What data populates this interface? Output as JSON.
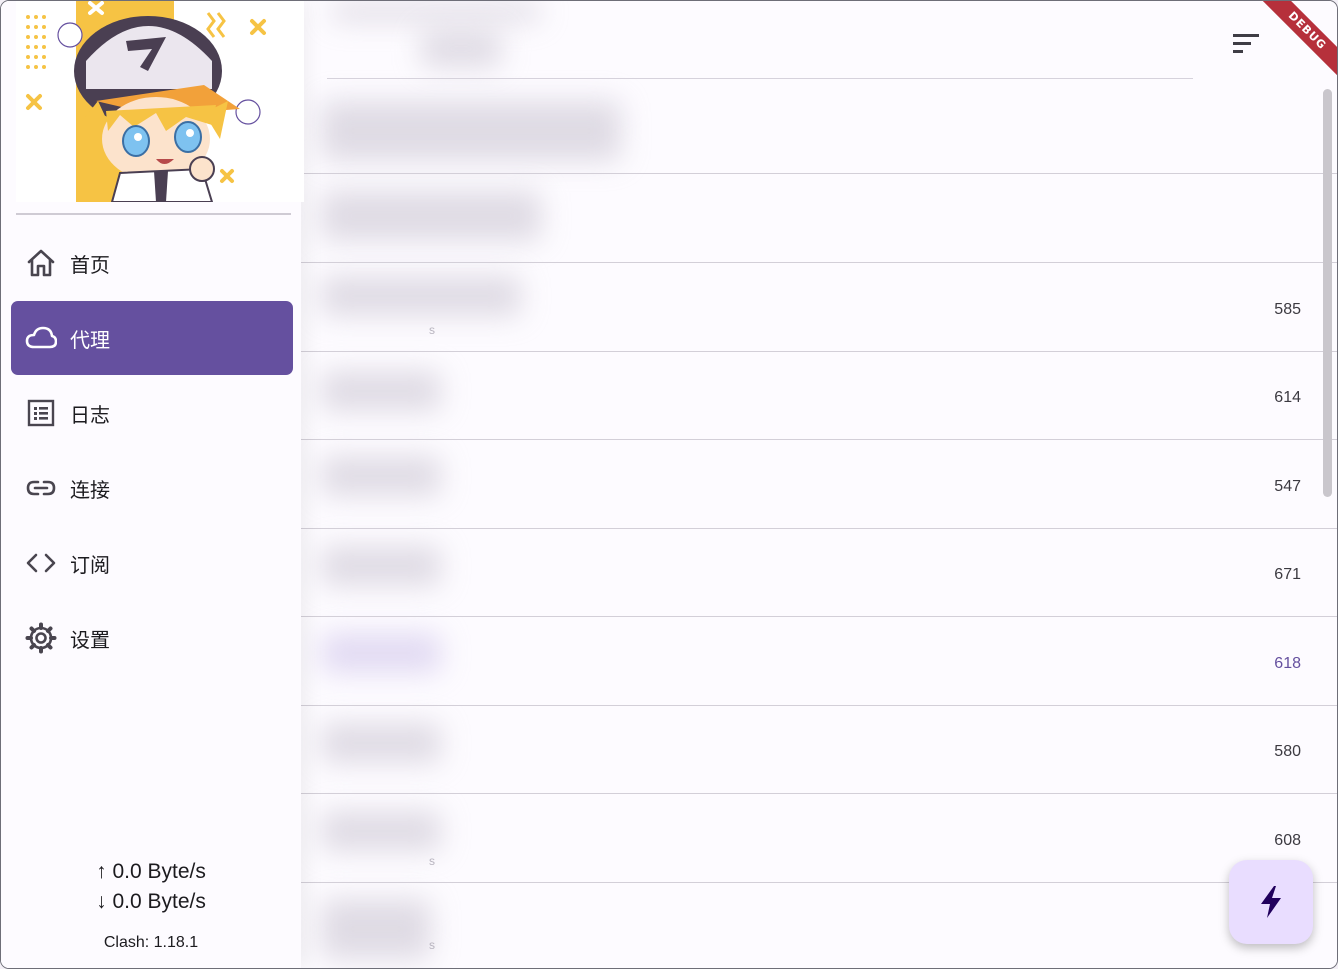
{
  "nav": {
    "items": [
      {
        "label": "首页",
        "icon": "home-icon"
      },
      {
        "label": "代理",
        "icon": "cloud-icon"
      },
      {
        "label": "日志",
        "icon": "list-icon"
      },
      {
        "label": "连接",
        "icon": "link-icon"
      },
      {
        "label": "订阅",
        "icon": "code-icon"
      },
      {
        "label": "设置",
        "icon": "gear-icon"
      }
    ],
    "active_index": 1
  },
  "status": {
    "upload": "↑ 0.0 Byte/s",
    "download": "↓ 0.0 Byte/s",
    "version": "Clash: 1.18.1"
  },
  "proxies": {
    "delays": [
      "585",
      "614",
      "547",
      "671",
      "618",
      "580",
      "608"
    ],
    "selected_index": 4
  },
  "banner": "DEBUG",
  "colors": {
    "accent": "#65509f",
    "selected_delay": "#65509f",
    "fab_bg": "#e9ddff",
    "debug_banner": "#b6303b"
  }
}
